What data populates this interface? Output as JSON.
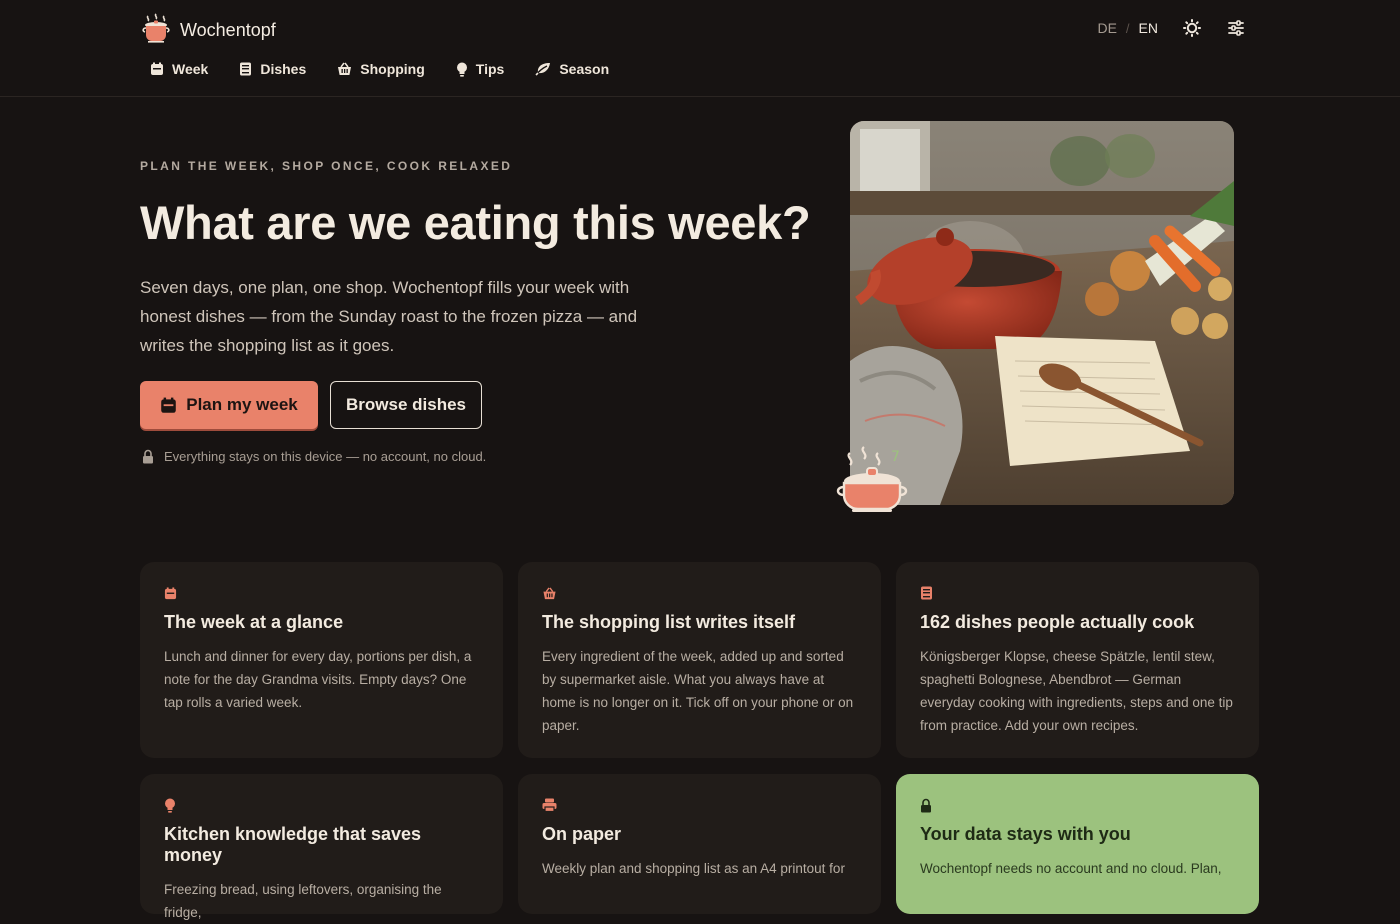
{
  "app": {
    "name": "Wochentopf",
    "accent": "#e9826a"
  },
  "header": {
    "languages": [
      "DE",
      "EN"
    ],
    "active_language": "EN",
    "icons": [
      "sun-icon",
      "sliders-icon"
    ]
  },
  "nav": [
    {
      "label": "Week",
      "icon": "calendar-icon"
    },
    {
      "label": "Dishes",
      "icon": "book-icon"
    },
    {
      "label": "Shopping",
      "icon": "basket-icon"
    },
    {
      "label": "Tips",
      "icon": "lightbulb-icon"
    },
    {
      "label": "Season",
      "icon": "leaf-icon"
    }
  ],
  "hero": {
    "eyebrow": "PLAN THE WEEK, SHOP ONCE, COOK RELAXED",
    "title": "What are we eating this week?",
    "text": "Seven days, one plan, one shop. Wochentopf fills your week with honest dishes — from the Sunday roast to the frozen pizza — and writes the shopping list as it goes.",
    "primary_button": "Plan my week",
    "secondary_button": "Browse dishes",
    "privacy_note": "Everything stays on this device — no account, no cloud."
  },
  "cards": [
    {
      "icon": "calendar-icon",
      "title": "The week at a glance",
      "text": "Lunch and dinner for every day, portions per dish, a note for the day Grandma visits. Empty days? One tap rolls a varied week."
    },
    {
      "icon": "basket-icon",
      "title": "The shopping list writes itself",
      "text": "Every ingredient of the week, added up and sorted by supermarket aisle. What you always have at home is no longer on it. Tick off on your phone or on paper."
    },
    {
      "icon": "book-icon",
      "title": "162 dishes people actually cook",
      "text": "Königsberger Klopse, cheese Spätzle, lentil stew, spaghetti Bolognese, Abendbrot — German everyday cooking with ingredients, steps and one tip from practice. Add your own recipes."
    },
    {
      "icon": "lightbulb-icon",
      "title": "Kitchen knowledge that saves money",
      "text": "Freezing bread, using leftovers, organising the fridge,"
    },
    {
      "icon": "printer-icon",
      "title": "On paper",
      "text": "Weekly plan and shopping list as an A4 printout for"
    },
    {
      "icon": "lock-icon",
      "title": "Your data stays with you",
      "text": "Wochentopf needs no account and no cloud. Plan,"
    }
  ]
}
